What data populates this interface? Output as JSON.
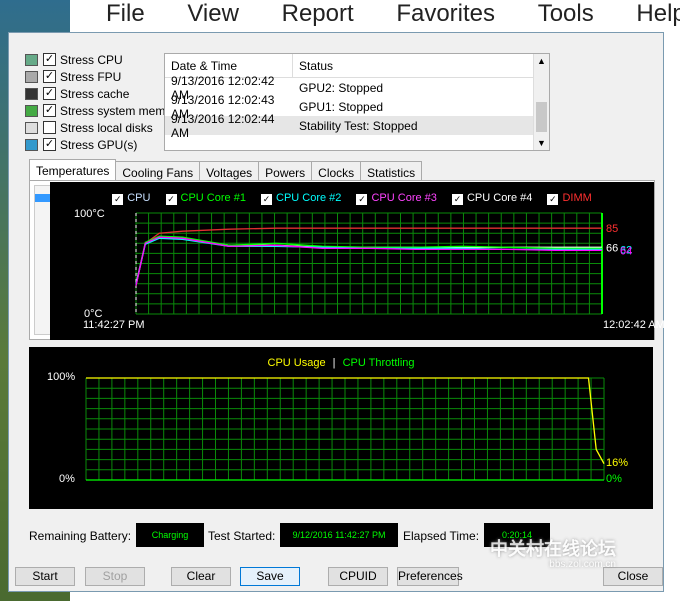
{
  "background": {
    "menu": [
      "File",
      "View",
      "Report",
      "Favorites",
      "Tools",
      "Help"
    ]
  },
  "stress": [
    {
      "label": "Stress CPU",
      "checked": true,
      "icon": "cpu-icon"
    },
    {
      "label": "Stress FPU",
      "checked": true,
      "icon": "fpu-icon"
    },
    {
      "label": "Stress cache",
      "checked": true,
      "icon": "cache-icon"
    },
    {
      "label": "Stress system mem",
      "checked": true,
      "icon": "memory-icon"
    },
    {
      "label": "Stress local disks",
      "checked": false,
      "icon": "disk-icon"
    },
    {
      "label": "Stress GPU(s)",
      "checked": true,
      "icon": "gpu-icon"
    }
  ],
  "log": {
    "col_date": "Date & Time",
    "col_status": "Status",
    "rows": [
      {
        "date": "9/13/2016 12:02:42 AM",
        "status": "GPU2: Stopped"
      },
      {
        "date": "9/13/2016 12:02:43 AM",
        "status": "GPU1: Stopped"
      },
      {
        "date": "9/13/2016 12:02:44 AM",
        "status": "Stability Test: Stopped"
      }
    ]
  },
  "tabs": [
    "Temperatures",
    "Cooling Fans",
    "Voltages",
    "Powers",
    "Clocks",
    "Statistics"
  ],
  "chart_data": [
    {
      "type": "line",
      "legend": [
        {
          "name": "CPU",
          "color": "#ffffff",
          "checked": true
        },
        {
          "name": "CPU Core #1",
          "color": "#00ff00",
          "checked": true
        },
        {
          "name": "CPU Core #2",
          "color": "#00ffff",
          "checked": true
        },
        {
          "name": "CPU Core #3",
          "color": "#ff00ff",
          "checked": true
        },
        {
          "name": "CPU Core #4",
          "color": "#ffffff",
          "checked": true
        },
        {
          "name": "DIMM",
          "color": "#ff3030",
          "checked": true
        }
      ],
      "ymax_label": "100°C",
      "ymin_label": "0°C",
      "ylim": [
        0,
        100
      ],
      "x_start_label": "11:42:27 PM",
      "x_end_label": "12:02:42 AM",
      "end_value_labels": [
        {
          "text": "85",
          "value": 85,
          "color": "#ff3030"
        },
        {
          "text": "66",
          "value": 66,
          "color": "#ffffff"
        },
        {
          "text": "62",
          "value": 64,
          "color": "#00ffff"
        },
        {
          "text": "64",
          "value": 63,
          "color": "#ff00ff"
        }
      ],
      "series": [
        {
          "name": "DIMM",
          "color": "#e03030",
          "x": [
            0,
            2,
            5,
            10,
            20,
            30,
            40,
            50,
            60,
            70,
            80,
            90,
            100
          ],
          "values": [
            28,
            70,
            80,
            82,
            84,
            85,
            85,
            85,
            85,
            85,
            85,
            85,
            85
          ]
        },
        {
          "name": "CPU",
          "color": "#ffffff",
          "x": [
            0,
            2,
            5,
            10,
            20,
            30,
            40,
            50,
            60,
            70,
            80,
            90,
            100
          ],
          "values": [
            30,
            70,
            76,
            75,
            68,
            68,
            66,
            66,
            66,
            66,
            66,
            66,
            66
          ]
        },
        {
          "name": "CPU Core #1",
          "color": "#00ff00",
          "x": [
            0,
            2,
            5,
            10,
            20,
            30,
            40,
            50,
            60,
            70,
            80,
            90,
            100
          ],
          "values": [
            28,
            71,
            77,
            76,
            68,
            70,
            67,
            66,
            66,
            67,
            66,
            65,
            65
          ]
        },
        {
          "name": "CPU Core #2",
          "color": "#00ffff",
          "x": [
            0,
            2,
            5,
            10,
            20,
            30,
            40,
            50,
            60,
            70,
            80,
            90,
            100
          ],
          "values": [
            29,
            69,
            75,
            74,
            67,
            67,
            66,
            65,
            65,
            65,
            64,
            64,
            64
          ]
        },
        {
          "name": "CPU Core #3",
          "color": "#ff00ff",
          "x": [
            0,
            2,
            5,
            10,
            20,
            30,
            40,
            50,
            60,
            70,
            80,
            90,
            100
          ],
          "values": [
            28,
            70,
            76,
            75,
            67,
            68,
            65,
            65,
            64,
            64,
            64,
            63,
            63
          ]
        }
      ]
    },
    {
      "type": "line",
      "legend_usage": "CPU Usage",
      "legend_sep": "|",
      "legend_throttle": "CPU Throttling",
      "usage_color": "#ffff00",
      "throttle_color": "#00ff00",
      "ymax_label": "100%",
      "ymin_label": "0%",
      "ylim": [
        0,
        100
      ],
      "usage_end_label": "16%",
      "throttle_end_label": "0%",
      "series": [
        {
          "name": "CPU Usage",
          "x": [
            0,
            97,
            98.5,
            100
          ],
          "values": [
            100,
            100,
            30,
            16
          ]
        },
        {
          "name": "CPU Throttling",
          "x": [
            0,
            100
          ],
          "values": [
            0,
            0
          ]
        }
      ]
    }
  ],
  "status": {
    "battery_label": "Remaining Battery:",
    "battery_value": "Charging",
    "started_label": "Test Started:",
    "started_value": "9/12/2016 11:42:27 PM",
    "elapsed_label": "Elapsed Time:",
    "elapsed_value": "0:20:14"
  },
  "buttons": {
    "start": "Start",
    "stop": "Stop",
    "clear": "Clear",
    "save": "Save",
    "cpuid": "CPUID",
    "preferences": "Preferences",
    "close": "Close"
  },
  "watermark": {
    "main": "中关村在线论坛",
    "sub": "bbs.zol.com.cn"
  }
}
